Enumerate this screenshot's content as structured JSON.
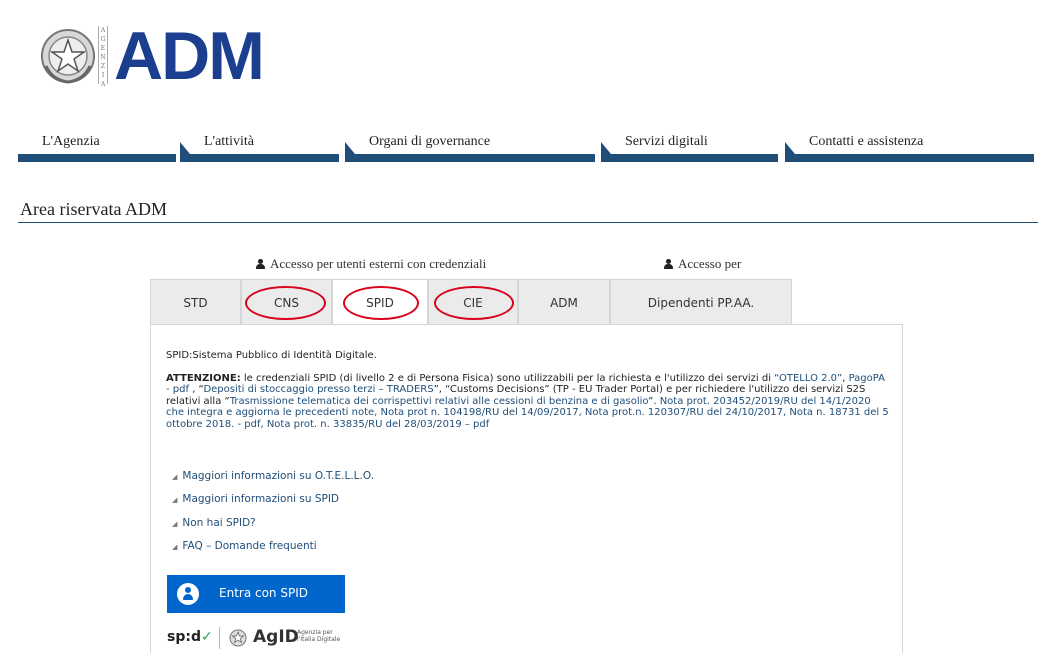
{
  "brand": {
    "name": "ADM",
    "vertical_word": [
      "A",
      "G",
      "E",
      "N",
      "Z",
      "I",
      "A"
    ],
    "color": "#1b3e8f"
  },
  "nav": {
    "items": [
      {
        "label": "L'Agenzia"
      },
      {
        "label": "L'attività"
      },
      {
        "label": "Organi di governance"
      },
      {
        "label": "Servizi digitali"
      },
      {
        "label": "Contatti e assistenza"
      }
    ],
    "bar_color": "#1f4e79"
  },
  "section_title": "Area riservata ADM",
  "access": {
    "external": "Accesso per utenti esterni con credenziali",
    "other": "Accesso per"
  },
  "tabs": [
    {
      "label": "STD",
      "active": false,
      "circled": false
    },
    {
      "label": "CNS",
      "active": false,
      "circled": true
    },
    {
      "label": "SPID",
      "active": true,
      "circled": true
    },
    {
      "label": "CIE",
      "active": false,
      "circled": true
    },
    {
      "label": "ADM",
      "active": false,
      "circled": false
    },
    {
      "label": "Dipendenti PP.AA.",
      "active": false,
      "circled": false
    }
  ],
  "annotation_color": "#d9001b",
  "content": {
    "intro": "SPID:Sistema Pubblico di Identità Digitale.",
    "attention_label": "ATTENZIONE:",
    "attention_text_1": " le credenziali SPID (di livello 2 e di Persona Fisica) sono utilizzabili per la richiesta e l'utilizzo dei servizi di ",
    "link_otello": "“OTELLO 2.0”",
    "sep_1": ", ",
    "link_pagopa": "PagoPA - pdf",
    "sep_2": " , “",
    "link_depositi": "Depositi di stoccaggio presso terzi – TRADERS",
    "sep_3": "”, “Customs Decisions” (TP - EU Trader Portal) e per richiedere l'utilizzo dei servizi S2S relativi alla “",
    "link_trasmissione": "Trasmissione telematica dei corrispettivi relativi alle cessioni di benzina e di gasolio",
    "sep_4": "”. ",
    "notes": "Nota prot. 203452/2019/RU del 14/1/2020 che integra e aggiorna le precedenti note,  Nota prot n. 104198/RU del 14/09/2017,  Nota prot.n. 120307/RU del 24/10/2017, Nota n. 18731 del 5 ottobre 2018. - pdf, Nota prot. n. 33835/RU del 28/03/2019 – pdf"
  },
  "links": [
    {
      "label": "Maggiori informazioni su O.T.E.L.L.O."
    },
    {
      "label": "Maggiori informazioni su SPID"
    },
    {
      "label": "Non hai SPID?"
    },
    {
      "label": "FAQ – Domande frequenti"
    }
  ],
  "spid_button": {
    "label": "Entra con SPID",
    "color": "#0066cc"
  },
  "footer": {
    "spid_logo": "sp:d",
    "spid_check": "✓",
    "agid": "AgID",
    "agid_sub": "Agenzia per l'Italia Digitale"
  }
}
